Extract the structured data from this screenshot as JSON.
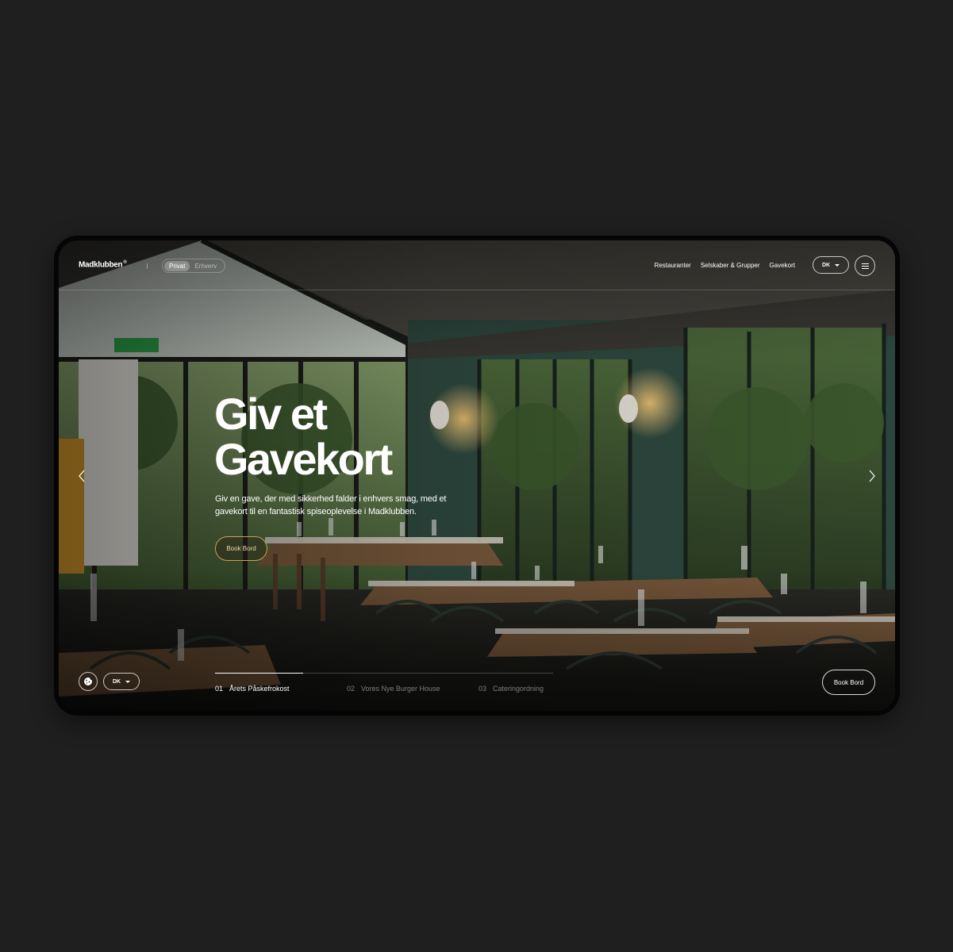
{
  "brand": {
    "logo": "Madklubben",
    "mark": "®"
  },
  "segment": {
    "options": [
      "Privat",
      "Erhverv"
    ],
    "active": "Privat"
  },
  "nav": {
    "items": [
      "Restauranter",
      "Selskaber & Grupper",
      "Gavekort"
    ]
  },
  "language": {
    "selected": "DK"
  },
  "hero": {
    "title_line1": "Giv et",
    "title_line2": "Gavekort",
    "subtitle": "Giv en gave, der med sikkerhed falder i enhvers smag, med et gavekort til en fantastisk spiseoplevelse i Madklubben.",
    "cta": "Book Bord"
  },
  "slider": {
    "progress": 0.26,
    "slides": [
      {
        "num": "01",
        "label": "Årets Påskefrokost"
      },
      {
        "num": "02",
        "label": "Vores Nye Burger House"
      },
      {
        "num": "03",
        "label": "Cateringordning"
      }
    ],
    "active_index": 0
  },
  "footer_bar": {
    "language": "DK",
    "book_button": "Book Bord"
  },
  "colors": {
    "accent_gold": "#c9a15a",
    "background": "#1f1f1f"
  }
}
